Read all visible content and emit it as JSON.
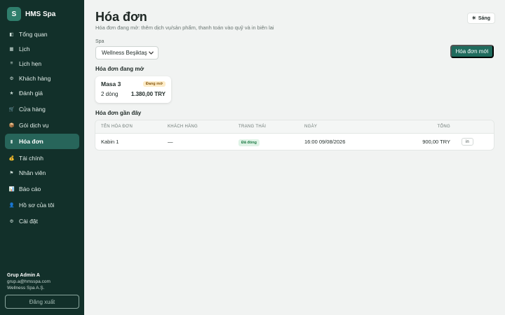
{
  "brand": {
    "logo_letter": "S",
    "name": "HMS Spa"
  },
  "nav": [
    {
      "icon": "overview-icon",
      "glyph": "◧",
      "label": "Tổng quan"
    },
    {
      "icon": "calendar-icon",
      "glyph": "▦",
      "label": "Lịch"
    },
    {
      "icon": "appointments-icon",
      "glyph": "≡",
      "label": "Lịch hẹn"
    },
    {
      "icon": "customers-icon",
      "glyph": "⚙",
      "label": "Khách hàng"
    },
    {
      "icon": "star-icon",
      "glyph": "★",
      "label": "Đánh giá"
    },
    {
      "icon": "cart-icon",
      "glyph": "🛒",
      "label": "Cửa hàng"
    },
    {
      "icon": "package-icon",
      "glyph": "📦",
      "label": "Gói dịch vụ"
    },
    {
      "icon": "invoice-icon",
      "glyph": "▮",
      "label": "Hóa đơn",
      "active": true
    },
    {
      "icon": "money-bag-icon",
      "glyph": "💰",
      "label": "Tài chính"
    },
    {
      "icon": "flag-icon",
      "glyph": "⚑",
      "label": "Nhân viên"
    },
    {
      "icon": "chart-icon",
      "glyph": "📊",
      "label": "Báo cáo"
    },
    {
      "icon": "profile-icon",
      "glyph": "👤",
      "label": "Hồ sơ của tôi"
    },
    {
      "icon": "settings-icon",
      "glyph": "⚙",
      "label": "Cài đặt"
    }
  ],
  "user": {
    "name": "Grup Admin A",
    "email": "grup.a@hmsspa.com",
    "company": "Wellness Spa A.Ş.",
    "logout_label": "Đăng xuất"
  },
  "header": {
    "title": "Hóa đơn",
    "subtitle": "Hóa đơn đang mở: thêm dịch vụ/sản phẩm, thanh toán vào quỹ và in biên lai",
    "theme_glyph": "☀",
    "theme_label": "Sáng"
  },
  "spa": {
    "label": "Spa",
    "selected": "Wellness Beşiktaş"
  },
  "new_invoice_label": "Hóa đơn mới",
  "open_invoices": {
    "title": "Hóa đơn đang mở",
    "items": [
      {
        "name": "Masa 3",
        "status": "Đang mở",
        "lines": "2 dòng",
        "amount": "1.380,00 TRY"
      }
    ]
  },
  "recent": {
    "title": "Hóa đơn gần đây",
    "columns": [
      "TÊN HÓA ĐƠN",
      "KHÁCH HÀNG",
      "TRẠNG THÁI",
      "NGÀY",
      "TỔNG"
    ],
    "rows": [
      {
        "name": "Kabin 1",
        "customer": "—",
        "status": "Đã đóng",
        "date": "16:00 09/08/2026",
        "total": "900,00 TRY",
        "action": "in"
      }
    ]
  },
  "colors": {
    "sidebar_bg": "#12302a",
    "accent": "#1f6b5d",
    "active_nav": "#27655a",
    "badge_open_bg": "#fdecc8",
    "badge_closed_bg": "#dff3e6"
  }
}
